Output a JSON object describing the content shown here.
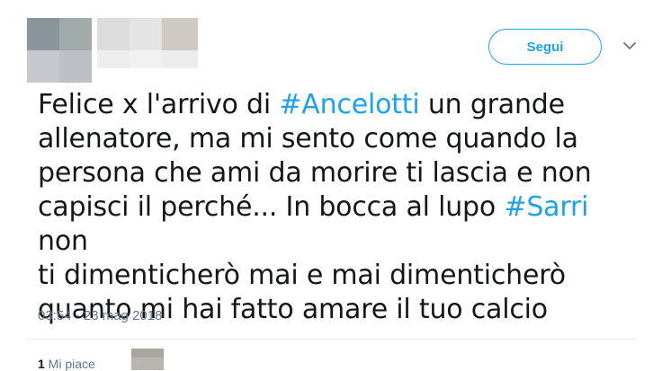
{
  "follow_button": {
    "label": "Segui"
  },
  "tweet": {
    "lines": [
      {
        "before": "Felice x l'arrivo di ",
        "hashtag": "#Ancelotti",
        "after": " un grande"
      },
      {
        "before": "allenatore, ma mi sento come quando la",
        "hashtag": "",
        "after": ""
      },
      {
        "before": "persona che ami da morire ti lascia e non",
        "hashtag": "",
        "after": ""
      },
      {
        "before": "capisci il perché... In bocca al lupo ",
        "hashtag": "#Sarri",
        "after": " non"
      },
      {
        "before": "ti dimenticherò mai e mai dimenticherò",
        "hashtag": "",
        "after": ""
      },
      {
        "before": "quanto mi hai fatto amare il tuo calcio",
        "hashtag": "",
        "after": ""
      }
    ],
    "timestamp": "03:54 - 23 mag 2018"
  },
  "likes": {
    "count": "1",
    "label": " Mi piace"
  },
  "colors": {
    "accent": "#1da1f2",
    "text": "#14171a",
    "muted": "#657786"
  },
  "icons": {
    "more": "chevron-down-icon"
  }
}
